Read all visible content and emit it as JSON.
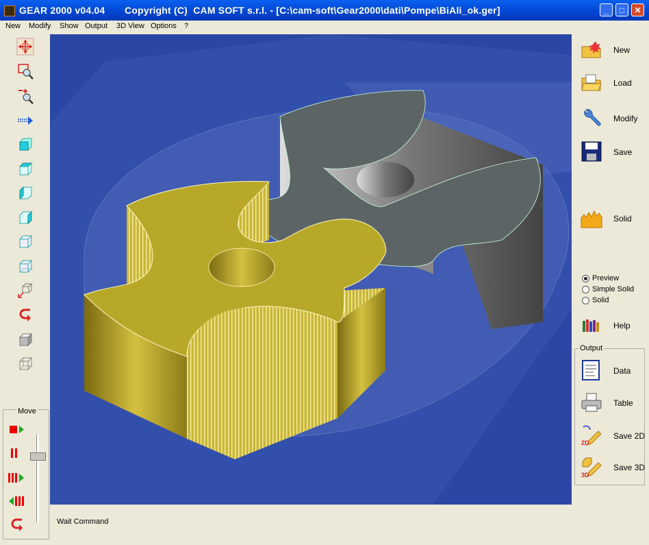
{
  "window": {
    "title": "GEAR 2000 v04.04       Copyright (C)  CAM SOFT s.r.l. - [C:\\cam-soft\\Gear2000\\dati\\Pompe\\BiAli_ok.ger]",
    "minimize_glyph": "_",
    "maximize_glyph": "□",
    "close_glyph": "✕"
  },
  "menu": [
    {
      "label": "New"
    },
    {
      "label": "Modify"
    },
    {
      "label": "Show"
    },
    {
      "label": "Output"
    },
    {
      "label": "3D View"
    },
    {
      "label": "Options"
    },
    {
      "label": "?"
    }
  ],
  "left_toolbar": {
    "icons": [
      "pan-icon",
      "zoom-window-icon",
      "zoom-in-out-icon",
      "shift-arrow-icon",
      "view-front-icon",
      "view-top-icon",
      "view-left-icon",
      "view-right-icon",
      "view-iso-icon",
      "view-iso2-icon",
      "view-axes-icon",
      "undo-view-icon",
      "solid-box-icon",
      "wire-box-icon"
    ]
  },
  "move": {
    "label": "Move",
    "icons": [
      "play-icon",
      "pause-icon",
      "fast-forward-icon",
      "rewind-icon",
      "return-icon"
    ],
    "speed_level": 0.22
  },
  "right_panel": {
    "new_label": "New",
    "load_label": "Load",
    "modify_label": "Modify",
    "save_label": "Save",
    "solid_label": "Solid",
    "help_label": "Help",
    "radio": {
      "preview": "Preview",
      "simple_solid": "Simple Solid",
      "solid": "Solid",
      "selected": "preview"
    }
  },
  "output": {
    "label": "Output",
    "data_label": "Data",
    "table_label": "Table",
    "save2d_label": "Save 2D",
    "save3d_label": "Save 3D",
    "badge_2d": "2D",
    "badge_3d": "3D"
  },
  "status": {
    "text": "Wait Command"
  },
  "colors": {
    "viewport_bg": "#2B47A6",
    "gear_yellow": "#B8A82A",
    "gear_gray": "#5C6466"
  }
}
